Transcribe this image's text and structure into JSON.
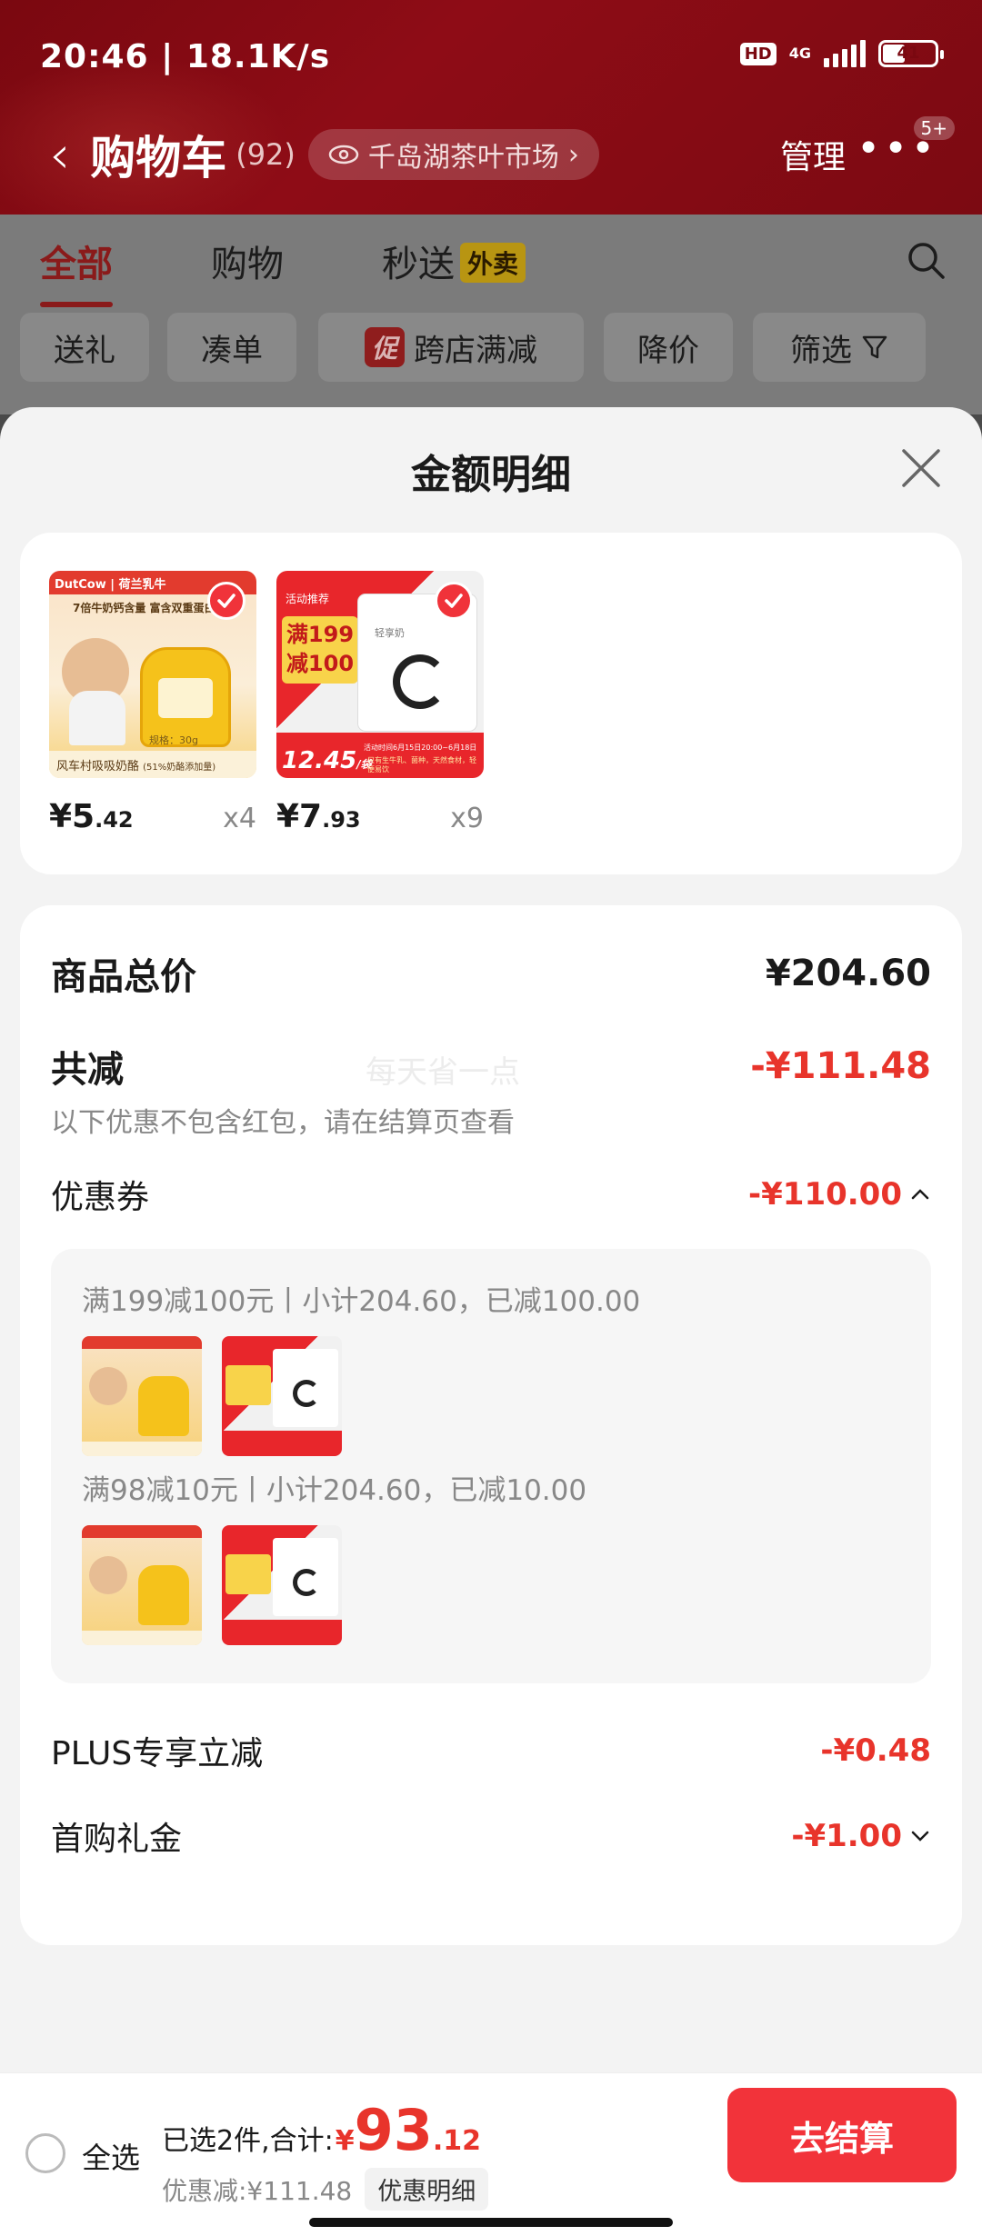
{
  "status_bar": {
    "time": "20:46",
    "speed": "18.1K/s",
    "hd": "HD",
    "network": "4G",
    "battery": "41"
  },
  "header": {
    "back": "‹",
    "title": "购物车",
    "count": "(92)",
    "location": "千岛湖茶叶市场",
    "manage": "管理",
    "more_badge": "5+"
  },
  "tabs": [
    {
      "label": "全部",
      "active": true
    },
    {
      "label": "购物"
    },
    {
      "label": "秒送",
      "badge": "外卖"
    }
  ],
  "chips": [
    "送礼",
    "凑单",
    "跨店满减",
    "降价",
    "筛选"
  ],
  "chip_promo_tag": "促",
  "sheet": {
    "title": "金额明细",
    "products": [
      {
        "name": "风车村吸吸奶酪",
        "price_int": "¥5",
        "price_dec": ".42",
        "qty": "x4"
      },
      {
        "name": "轻享奶",
        "price_int": "¥7",
        "price_dec": ".93",
        "qty": "x9"
      }
    ],
    "product_img_text": {
      "p1_brand": "DutCow | 荷兰乳牛",
      "p1_headline": "7倍牛奶钙含量 富含双重蛋白",
      "p1_spec": "规格：30g",
      "p1_caption": "风车村吸吸奶酪",
      "p1_caption_note": "(51%奶酪添加量)",
      "p2_tag": "活动推荐",
      "p2_promo_1": "满199",
      "p2_promo_2": "减100",
      "p2_price": "12.45",
      "p2_unit": "/袋",
      "p2_pack": "轻享奶",
      "p2_date": "活动时间6月15日20:00~6月18日",
      "p2_desc": "只有生牛乳、菌种，天然食材，轻便易饮"
    },
    "total_label": "商品总价",
    "total_value": "¥204.60",
    "discount_label": "共减",
    "discount_value": "-¥111.48",
    "discount_note": "以下优惠不包含红包，请在结算页查看",
    "watermark": "每天省一点",
    "coupon_label": "优惠券",
    "coupon_value": "-¥110.00",
    "coupons": [
      {
        "text": "满199减100元丨小计204.60，已减100.00"
      },
      {
        "text": "满98减10元丨小计204.60，已减10.00"
      }
    ],
    "plus_label": "PLUS专享立减",
    "plus_value": "-¥0.48",
    "gift_label": "首购礼金",
    "gift_value": "-¥1.00"
  },
  "bottom": {
    "select_all": "全选",
    "selected_prefix": "已选2件,合计:",
    "currency": "¥",
    "total_int": "93",
    "total_dec": ".12",
    "saved": "优惠减:¥111.48",
    "detail_btn": "优惠明细",
    "checkout": "去结算"
  },
  "colors": {
    "accent": "#f2333a",
    "header": "#8e0c16",
    "discount": "#e8342b"
  }
}
